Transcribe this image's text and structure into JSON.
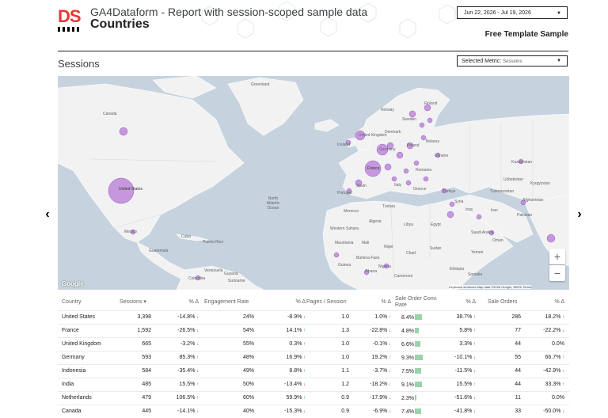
{
  "header": {
    "logo_text": "DS",
    "title": "GA4Dataform - Report with session-scoped sample data",
    "subtitle": "Countries",
    "date_range": "Jun 22, 2026 - Jul 19, 2026",
    "template_label": "Free Template Sample"
  },
  "section": {
    "title": "Sessions",
    "metric_label": "Selected Metric:",
    "metric_value": "Sessions"
  },
  "colors": {
    "bubble": "#b57ad6",
    "land": "#f2f2f2",
    "water": "#c6d3df",
    "accent": "#e53935"
  },
  "map": {
    "labels": [
      {
        "text": "Greenland"
      },
      {
        "text": "Canada"
      },
      {
        "text": "United States"
      },
      {
        "text": "Mexico"
      },
      {
        "text": "Cuba"
      },
      {
        "text": "Puerto Rico"
      },
      {
        "text": "Guatemala"
      },
      {
        "text": "Venezuela"
      },
      {
        "text": "Colombia"
      },
      {
        "text": "Guyana"
      },
      {
        "text": "Suriname"
      },
      {
        "text": "North Atlantic Ocean"
      },
      {
        "text": "Iceland"
      },
      {
        "text": "Norway"
      },
      {
        "text": "Sweden"
      },
      {
        "text": "Finland"
      },
      {
        "text": "United Kingdom"
      },
      {
        "text": "Denmark"
      },
      {
        "text": "Belarus"
      },
      {
        "text": "Poland"
      },
      {
        "text": "Germany"
      },
      {
        "text": "Ukraine"
      },
      {
        "text": "France"
      },
      {
        "text": "Romania"
      },
      {
        "text": "Spain"
      },
      {
        "text": "Portugal"
      },
      {
        "text": "Italy"
      },
      {
        "text": "Greece"
      },
      {
        "text": "Türkiye"
      },
      {
        "text": "Kazakhstan"
      },
      {
        "text": "Uzbekistan"
      },
      {
        "text": "Kyrgyzstan"
      },
      {
        "text": "Turkmenistan"
      },
      {
        "text": "Tunisia"
      },
      {
        "text": "Morocco"
      },
      {
        "text": "Algeria"
      },
      {
        "text": "Libya"
      },
      {
        "text": "Egypt"
      },
      {
        "text": "Syria"
      },
      {
        "text": "Iraq"
      },
      {
        "text": "Iran"
      },
      {
        "text": "Afghanistan"
      },
      {
        "text": "Pakistan"
      },
      {
        "text": "Saudi Arabia"
      },
      {
        "text": "Oman"
      },
      {
        "text": "Yemen"
      },
      {
        "text": "Western Sahara"
      },
      {
        "text": "Mauritania"
      },
      {
        "text": "Mali"
      },
      {
        "text": "Niger"
      },
      {
        "text": "Chad"
      },
      {
        "text": "Sudan"
      },
      {
        "text": "Burkina Faso"
      },
      {
        "text": "Guinea"
      },
      {
        "text": "Nigeria"
      },
      {
        "text": "Ghana"
      },
      {
        "text": "Ethiopia"
      },
      {
        "text": "Somalia"
      },
      {
        "text": "Cameroon"
      }
    ],
    "google_label": "Google",
    "attribution": "Keyboard shortcuts   Map data ©2026 Google, INEGI   Terms",
    "zoom_in": "+",
    "zoom_out": "−"
  },
  "nav": {
    "prev": "‹",
    "next": "›"
  },
  "table": {
    "columns": [
      "Country",
      "Sessions ▾",
      "% Δ",
      "Engagement Rate",
      "% Δ",
      "Pages / Session",
      "% Δ",
      "Sale Order Conv. Rate",
      "% Δ",
      "Sale Orders",
      "% Δ"
    ],
    "rows": [
      {
        "country": "United States",
        "sessions": "3,398",
        "sessions_d": "-14.8%",
        "sessions_dir": "down",
        "eng": "24%",
        "eng_d": "-8.9%",
        "eng_dir": "down",
        "pps": "1.0",
        "pps_d": "1.0%",
        "pps_dir": "up",
        "conv": "8.4%",
        "conv_frac": 0.22,
        "conv_d": "38.7%",
        "conv_dir": "up",
        "orders": "286",
        "orders_d": "18.2%",
        "orders_dir": "up"
      },
      {
        "country": "France",
        "sessions": "1,592",
        "sessions_d": "-26.5%",
        "sessions_dir": "down",
        "eng": "54%",
        "eng_d": "14.1%",
        "eng_dir": "up",
        "pps": "1.3",
        "pps_d": "-22.8%",
        "pps_dir": "down",
        "conv": "4.8%",
        "conv_frac": 0.12,
        "conv_d": "5.8%",
        "conv_dir": "up",
        "orders": "77",
        "orders_d": "-22.2%",
        "orders_dir": "down"
      },
      {
        "country": "United Kingdom",
        "sessions": "665",
        "sessions_d": "-3.2%",
        "sessions_dir": "down",
        "eng": "55%",
        "eng_d": "0.3%",
        "eng_dir": "up",
        "pps": "1.0",
        "pps_d": "-0.1%",
        "pps_dir": "down",
        "conv": "6.6%",
        "conv_frac": 0.17,
        "conv_d": "3.3%",
        "conv_dir": "up",
        "orders": "44",
        "orders_d": "0.0%",
        "orders_dir": ""
      },
      {
        "country": "Germany",
        "sessions": "593",
        "sessions_d": "85.3%",
        "sessions_dir": "up",
        "eng": "48%",
        "eng_d": "16.9%",
        "eng_dir": "up",
        "pps": "1.0",
        "pps_d": "19.2%",
        "pps_dir": "up",
        "conv": "9.3%",
        "conv_frac": 0.24,
        "conv_d": "-10.1%",
        "conv_dir": "down",
        "orders": "55",
        "orders_d": "66.7%",
        "orders_dir": "up"
      },
      {
        "country": "Indonesia",
        "sessions": "584",
        "sessions_d": "-35.4%",
        "sessions_dir": "down",
        "eng": "49%",
        "eng_d": "8.8%",
        "eng_dir": "up",
        "pps": "1.1",
        "pps_d": "-3.7%",
        "pps_dir": "down",
        "conv": "7.5%",
        "conv_frac": 0.19,
        "conv_d": "-11.5%",
        "conv_dir": "down",
        "orders": "44",
        "orders_d": "-42.9%",
        "orders_dir": "down"
      },
      {
        "country": "India",
        "sessions": "485",
        "sessions_d": "15.5%",
        "sessions_dir": "up",
        "eng": "50%",
        "eng_d": "-13.4%",
        "eng_dir": "down",
        "pps": "1.2",
        "pps_d": "-18.2%",
        "pps_dir": "down",
        "conv": "9.1%",
        "conv_frac": 0.23,
        "conv_d": "15.5%",
        "conv_dir": "up",
        "orders": "44",
        "orders_d": "33.3%",
        "orders_dir": "up"
      },
      {
        "country": "Netherlands",
        "sessions": "479",
        "sessions_d": "106.5%",
        "sessions_dir": "up",
        "eng": "60%",
        "eng_d": "59.9%",
        "eng_dir": "up",
        "pps": "0.9",
        "pps_d": "-17.9%",
        "pps_dir": "down",
        "conv": "2.3%",
        "conv_frac": 0.06,
        "conv_d": "-51.6%",
        "conv_dir": "down",
        "orders": "11",
        "orders_d": "0.0%",
        "orders_dir": ""
      },
      {
        "country": "Canada",
        "sessions": "445",
        "sessions_d": "-14.1%",
        "sessions_dir": "down",
        "eng": "40%",
        "eng_d": "-15.3%",
        "eng_dir": "down",
        "pps": "0.9",
        "pps_d": "-6.9%",
        "pps_dir": "down",
        "conv": "7.4%",
        "conv_frac": 0.19,
        "conv_d": "-41.8%",
        "conv_dir": "down",
        "orders": "33",
        "orders_d": "-50.0%",
        "orders_dir": "down"
      }
    ]
  }
}
